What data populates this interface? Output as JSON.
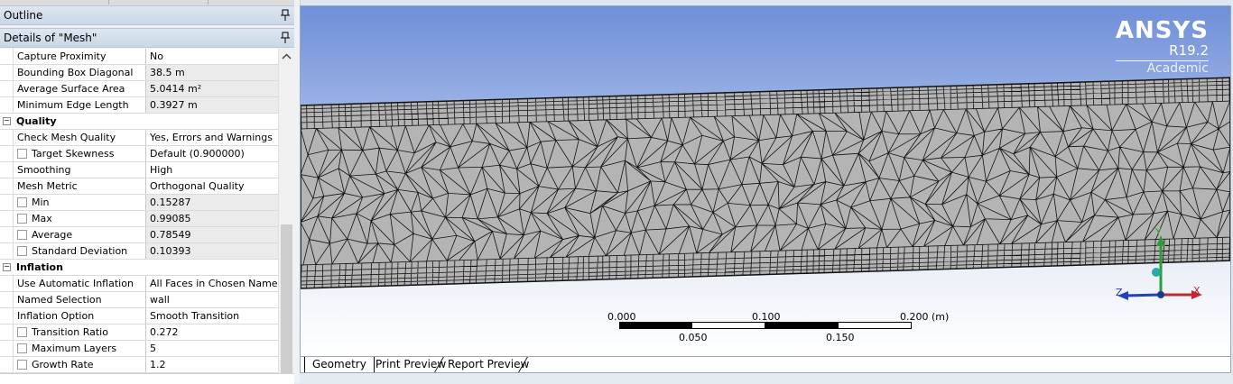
{
  "panels": {
    "outline_title": "Outline",
    "details_title": "Details of \"Mesh\""
  },
  "details": {
    "rows": [
      {
        "label": "Capture Proximity",
        "value": "No",
        "type": "prop",
        "readonly": false
      },
      {
        "label": "Bounding Box Diagonal",
        "value": "38.5 m",
        "type": "prop",
        "readonly": true
      },
      {
        "label": "Average Surface Area",
        "value": "5.0414 m²",
        "type": "prop",
        "readonly": true
      },
      {
        "label": "Minimum Edge Length",
        "value": "0.3927 m",
        "type": "prop",
        "readonly": true
      },
      {
        "label": "Quality",
        "value": "",
        "type": "group",
        "readonly": false
      },
      {
        "label": "Check Mesh Quality",
        "value": "Yes, Errors and Warnings",
        "type": "prop",
        "readonly": false
      },
      {
        "label": "Target Skewness",
        "value": "Default (0.900000)",
        "type": "checkbox",
        "readonly": false
      },
      {
        "label": "Smoothing",
        "value": "High",
        "type": "prop",
        "readonly": false
      },
      {
        "label": "Mesh Metric",
        "value": "Orthogonal Quality",
        "type": "prop",
        "readonly": false
      },
      {
        "label": "Min",
        "value": "0.15287",
        "type": "checkbox",
        "readonly": true
      },
      {
        "label": "Max",
        "value": "0.99085",
        "type": "checkbox",
        "readonly": true
      },
      {
        "label": "Average",
        "value": "0.78549",
        "type": "checkbox",
        "readonly": true
      },
      {
        "label": "Standard Deviation",
        "value": "0.10393",
        "type": "checkbox",
        "readonly": true
      },
      {
        "label": "Inflation",
        "value": "",
        "type": "group",
        "readonly": false
      },
      {
        "label": "Use Automatic Inflation",
        "value": "All Faces in Chosen Name...",
        "type": "prop",
        "readonly": false
      },
      {
        "label": "Named Selection",
        "value": "wall",
        "type": "prop",
        "readonly": false
      },
      {
        "label": "Inflation Option",
        "value": "Smooth Transition",
        "type": "prop",
        "readonly": false
      },
      {
        "label": "Transition Ratio",
        "value": "0.272",
        "type": "checkbox",
        "readonly": false
      },
      {
        "label": "Maximum Layers",
        "value": "5",
        "type": "checkbox",
        "readonly": false
      },
      {
        "label": "Growth Rate",
        "value": "1.2",
        "type": "checkbox",
        "readonly": false
      }
    ]
  },
  "viewport": {
    "logo": {
      "name": "ANSYS",
      "version": "R19.2",
      "edition": "Academic"
    },
    "scale": {
      "top_labels": [
        "0.000",
        "0.100",
        "0.200 (m)"
      ],
      "bottom_labels": [
        "0.050",
        "0.150"
      ]
    },
    "triad": {
      "x": "X",
      "y": "Y",
      "z": "Z"
    },
    "colors": {
      "mesh_fill": "#b4b4b4",
      "mesh_line": "#111111",
      "x_axis": "#c0282e",
      "y_axis": "#2e9b3a",
      "z_axis": "#2040c0",
      "origin": "#2aa9a9"
    }
  },
  "tabs": [
    {
      "label": "Geometry",
      "active": true
    },
    {
      "label": "Print Preview",
      "active": false
    },
    {
      "label": "Report Preview",
      "active": false
    }
  ]
}
